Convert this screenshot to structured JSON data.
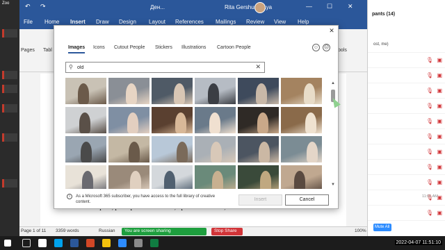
{
  "zoom": {
    "app_label": "Zoo"
  },
  "word": {
    "title_doc": "Ден...",
    "title_user": "Rita Gershunskaya",
    "tabs": [
      "File",
      "Home",
      "Insert",
      "Draw",
      "Design",
      "Layout",
      "References",
      "Mailings",
      "Review",
      "View",
      "Help"
    ],
    "ribbon_labels": {
      "pages": "Pages",
      "table": "Tabl",
      "symbols": "bols"
    },
    "doc_text": "внуки, вот они и дежурили подле него. Ну, дежурили – это уж сильно сказано. Так, пыль вытереть, разобраться с бельем, принести газеты,",
    "status": {
      "page": "Page 1 of 11",
      "words": "3359 words",
      "language": "Russian",
      "sharing": "You are screen sharing",
      "stop_share": "Stop Share",
      "zoom": "100%"
    }
  },
  "participants": {
    "title": "pants (14)",
    "host_label": "ost, me)",
    "mute_all": "Mute All",
    "time": "11:51 AM"
  },
  "dialog": {
    "tabs": [
      "Images",
      "Icons",
      "Cutout People",
      "Stickers",
      "Illustrations",
      "Cartoon People"
    ],
    "active_tab": "Images",
    "search_value": "old",
    "info_text": "As a Microsoft 365 subscriber, you have access to the full library of creative content.",
    "insert_label": "Insert",
    "cancel_label": "Cancel",
    "thumbnails_visible": 24
  },
  "taskbar": {
    "clock": "2022-04-07 11:51:10"
  },
  "colors": {
    "word_blue": "#2b579a",
    "share_green": "#1e9e3e",
    "stop_red": "#d13438",
    "zoom_blue": "#2d8cff"
  }
}
